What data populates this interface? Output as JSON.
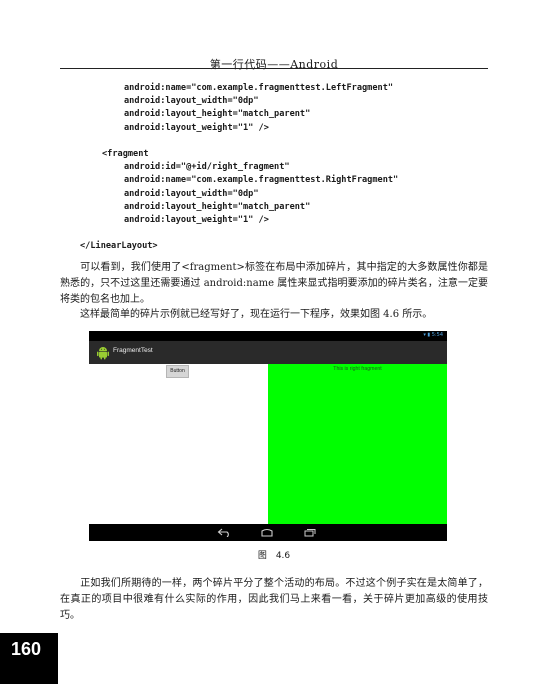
{
  "header": {
    "title": "第一行代码——Android"
  },
  "code_lines": [
    {
      "text": "android:name=\"com.example.fragmenttest.LeftFragment\"",
      "indent": 2
    },
    {
      "text": "android:layout_width=\"0dp\"",
      "indent": 2
    },
    {
      "text": "android:layout_height=\"match_parent\"",
      "indent": 2
    },
    {
      "text": "android:layout_weight=\"1\" />",
      "indent": 2
    },
    {
      "text": "",
      "indent": 0
    },
    {
      "text": "<fragment",
      "indent": 1
    },
    {
      "text": "android:id=\"@+id/right_fragment\"",
      "indent": 2
    },
    {
      "text": "android:name=\"com.example.fragmenttest.RightFragment\"",
      "indent": 2
    },
    {
      "text": "android:layout_width=\"0dp\"",
      "indent": 2
    },
    {
      "text": "android:layout_height=\"match_parent\"",
      "indent": 2
    },
    {
      "text": "android:layout_weight=\"1\" />",
      "indent": 2
    },
    {
      "text": "",
      "indent": 0
    },
    {
      "text": "</LinearLayout>",
      "indent": 0
    }
  ],
  "paragraphs": {
    "p1": "可以看到，我们使用了<fragment>标签在布局中添加碎片，其中指定的大多数属性你都是熟悉的，只不过这里还需要通过 android:name 属性来显式指明要添加的碎片类名，注意一定要将类的包名也加上。",
    "p2": "这样最简单的碎片示例就已经写好了，现在运行一下程序，效果如图 4.6 所示。",
    "p3": "正如我们所期待的一样，两个碎片平分了整个活动的布局。不过这个例子实在是太简单了，在真正的项目中很难有什么实际的作用，因此我们马上来看一看，关于碎片更加高级的使用技巧。"
  },
  "screenshot": {
    "status_time": "5:54",
    "app_title": "FragmentTest",
    "button_label": "Button",
    "right_text": "This is right fragment",
    "right_color": "#00ff00"
  },
  "caption": "图　4.6",
  "page_number": "160"
}
